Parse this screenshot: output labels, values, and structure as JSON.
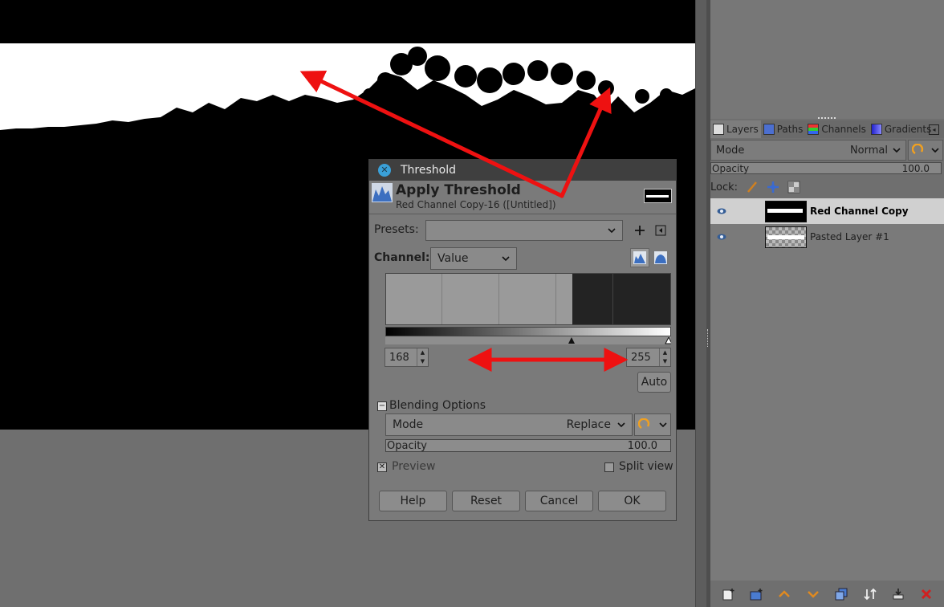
{
  "dialog": {
    "window_title": "Threshold",
    "heading": "Apply Threshold",
    "subtitle": "Red Channel Copy-16 ([Untitled])",
    "presets_label": "Presets:",
    "presets_value": "",
    "channel_label": "Channel:",
    "channel_value": "Value",
    "low_value": "168",
    "high_value": "255",
    "auto_label": "Auto",
    "blending_label": "Blending Options",
    "mode_label": "Mode",
    "mode_value": "Replace",
    "opacity_label": "Opacity",
    "opacity_value": "100.0",
    "preview_label": "Preview",
    "preview_checked": true,
    "split_view_label": "Split view",
    "split_view_checked": false,
    "buttons": {
      "help": "Help",
      "reset": "Reset",
      "cancel": "Cancel",
      "ok": "OK"
    }
  },
  "layers_panel": {
    "tabs": [
      {
        "label": "Layers",
        "icon": "layers-icon"
      },
      {
        "label": "Paths",
        "icon": "paths-icon"
      },
      {
        "label": "Channels",
        "icon": "channels-icon"
      },
      {
        "label": "Gradients",
        "icon": "gradients-icon"
      }
    ],
    "mode_label": "Mode",
    "mode_value": "Normal",
    "opacity_label": "Opacity",
    "opacity_value": "100.0",
    "lock_label": "Lock:",
    "layers": [
      {
        "name": "Red Channel Copy",
        "selected": true,
        "visible": true
      },
      {
        "name": "Pasted Layer #1",
        "selected": false,
        "visible": true
      }
    ],
    "bottom_icons": [
      "new-layer-icon",
      "new-group-icon",
      "raise-layer-icon",
      "lower-layer-icon",
      "duplicate-layer-icon",
      "anchor-layer-icon",
      "merge-layer-icon",
      "delete-layer-icon"
    ]
  },
  "colors": {
    "annotation_arrow": "#ee1111",
    "titlebar": "#3f3f3f",
    "close_button": "#3aa0d8"
  }
}
